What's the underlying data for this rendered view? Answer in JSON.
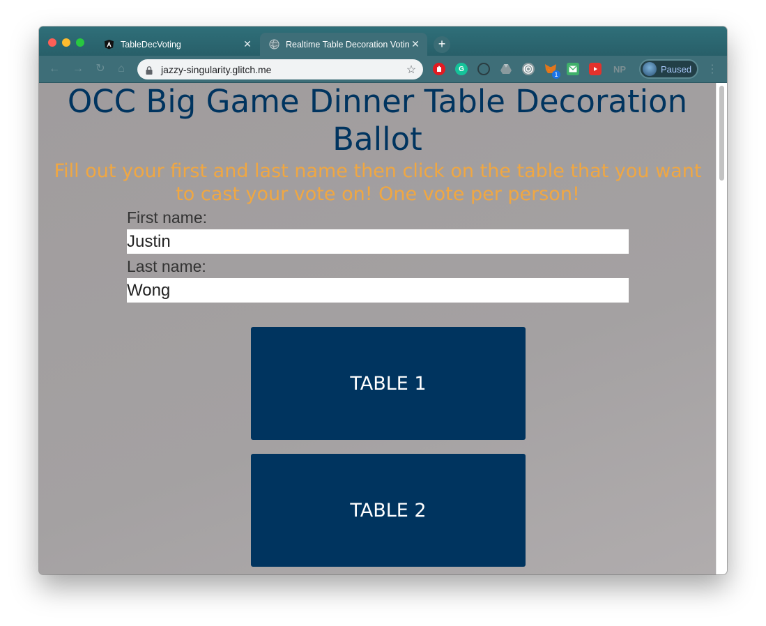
{
  "browser": {
    "tabs": [
      {
        "title": "TableDecVoting",
        "close": "✕",
        "active": false
      },
      {
        "title": "Realtime Table Decoration Voting",
        "close": "✕",
        "active": true
      }
    ],
    "new_tab": "+",
    "url": "jazzy-singularity.glitch.me",
    "extensions": [
      "ublock-icon",
      "grammarly-icon",
      "circle-icon",
      "drive-icon",
      "target-icon",
      "metamask-icon",
      "email-icon",
      "youtube-icon",
      "np-icon"
    ],
    "extension_badge": "1",
    "np_label": "NP",
    "profile_status": "Paused"
  },
  "page": {
    "title": "OCC Big Game Dinner Table Decoration Ballot",
    "subtitle": "Fill out your first and last name then click on the table that you want to cast your vote on! One vote per person!",
    "first_name_label": "First name:",
    "first_name_value": "Justin",
    "last_name_label": "Last name:",
    "last_name_value": "Wong",
    "tables": [
      "TABLE 1",
      "TABLE 2"
    ]
  },
  "colors": {
    "title": "#00345f",
    "subtitle": "#f0a742",
    "button_bg": "#00345f",
    "page_bg": "#a3a0a1",
    "tab_bar": "#2f6f79"
  }
}
